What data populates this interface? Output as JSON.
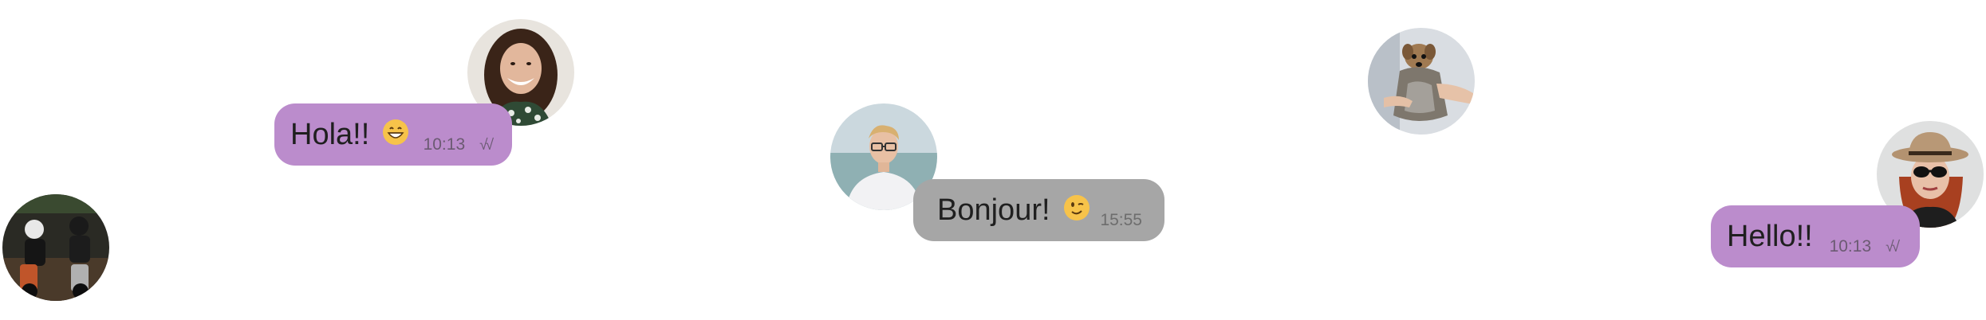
{
  "messages": [
    {
      "text": "Hola!!",
      "emoji": "grinning-face-icon",
      "time": "10:13",
      "status": "√√",
      "direction": "outgoing"
    },
    {
      "text": "Bonjour!",
      "emoji": "winking-face-icon",
      "time": "15:55",
      "direction": "incoming"
    },
    {
      "text": "Hello!!",
      "time": "10:13",
      "status": "√√",
      "direction": "outgoing"
    }
  ],
  "avatars": [
    "avatar-woman-curly-hair",
    "avatar-motorcyclists",
    "avatar-young-man-glasses",
    "avatar-dog",
    "avatar-woman-hat-sunglasses"
  ],
  "colors": {
    "outgoing_bubble": "#bb8ccc",
    "incoming_bubble": "#a6a6a6",
    "text": "#1f1f1f",
    "meta_text": "#6b5a72"
  }
}
